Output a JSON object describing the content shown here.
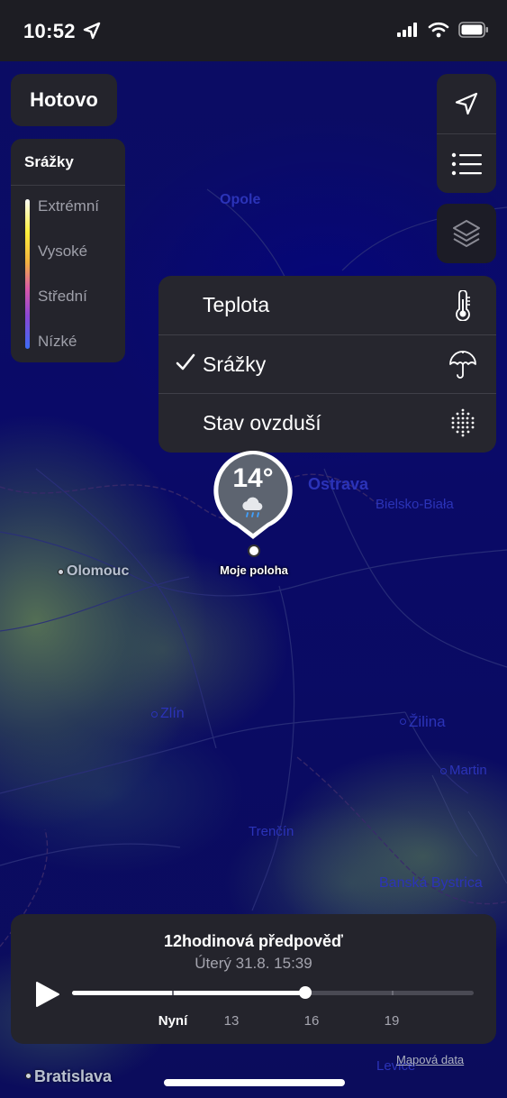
{
  "status_bar": {
    "time": "10:52",
    "icons": [
      "location-arrow-icon",
      "cellular-signal-icon",
      "wifi-icon",
      "battery-icon"
    ]
  },
  "toolbar": {
    "done_label": "Hotovo",
    "right_icons": [
      "location-arrow-icon",
      "list-icon",
      "layers-icon"
    ]
  },
  "legend": {
    "title": "Srážky",
    "levels": [
      "Extrémní",
      "Vysoké",
      "Střední",
      "Nízké"
    ]
  },
  "layer_menu": {
    "items": [
      {
        "label": "Teplota",
        "icon": "thermometer-icon",
        "selected": false
      },
      {
        "label": "Srážky",
        "icon": "umbrella-icon",
        "selected": true
      },
      {
        "label": "Stav ovzduší",
        "icon": "air-quality-icon",
        "selected": false
      }
    ]
  },
  "map": {
    "cities": [
      "Opole",
      "Ostrava",
      "Bielsko-Biała",
      "Olomouc",
      "Zlín",
      "Žilina",
      "Martin",
      "Trenčín",
      "Banská Bystrica",
      "Bratislava",
      "Levice"
    ],
    "marker": {
      "temperature": "14°",
      "icon": "cloud-rain-icon",
      "label": "Moje poloha"
    }
  },
  "forecast": {
    "title": "12hodinová předpověď",
    "subtitle": "Úterý 31.8. 15:39",
    "progress": 0.58,
    "tick_labels": [
      "Nyní",
      "13",
      "16",
      "19"
    ]
  },
  "footer": {
    "map_data_link": "Mapová data"
  },
  "colors": {
    "panel": "#24242c",
    "map_base": "#0a0a5e",
    "accent_blue": "#2b33b8"
  }
}
